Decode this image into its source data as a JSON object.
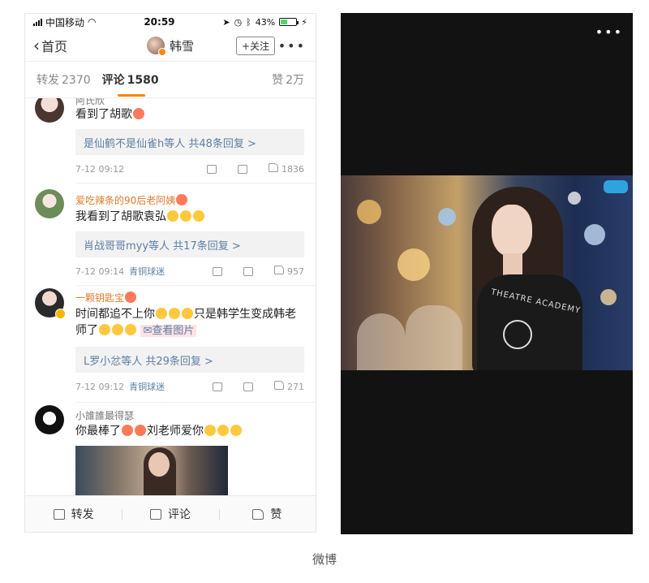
{
  "statusbar": {
    "carrier": "中国移动",
    "time": "20:59",
    "battery": "43%",
    "battery_level": 0.43
  },
  "navbar": {
    "back_label": "首页",
    "user_name": "韩雪",
    "follow_label": "+关注",
    "more": "•••"
  },
  "tabs": [
    {
      "label": "转发",
      "count": "2370"
    },
    {
      "label": "评论",
      "count": "1580"
    },
    {
      "label": "赞",
      "count": "2万"
    }
  ],
  "comments": [
    {
      "name": "阿氏欣",
      "text": "看到了胡歌",
      "reply": "是仙鹤不是仙雀h等人  共48条回复 >",
      "time": "7-12 09:12",
      "tag": "",
      "likes": "1836"
    },
    {
      "name": "爱吃辣条的90后老阿姨",
      "text": "我看到了胡歌袁弘",
      "reply": "肖战哥哥myy等人  共17条回复 >",
      "time": "7-12 09:14",
      "tag": "青铜球迷",
      "likes": "957"
    },
    {
      "name": "一颗钥匙宝",
      "text": "时间都追不上你",
      "text_b": "只是韩学生变成韩老师了",
      "see_image": "查看图片",
      "reply": "L罗小忿等人  共29条回复 >",
      "time": "7-12 09:12",
      "tag": "青铜球迷",
      "likes": "271"
    },
    {
      "name": "小誰誰最得瑟",
      "text": "你最棒了",
      "text_b": "刘老师爱你"
    }
  ],
  "bottombar": {
    "repost": "转发",
    "comment": "评论",
    "like": "赞"
  },
  "viewer": {
    "more": "•••"
  },
  "caption": "微博",
  "colors": {
    "accent": "#ff8200",
    "name_orange": "#e27b2e",
    "link_blue": "#5b7fa6",
    "viewer_bg": "#121212"
  }
}
